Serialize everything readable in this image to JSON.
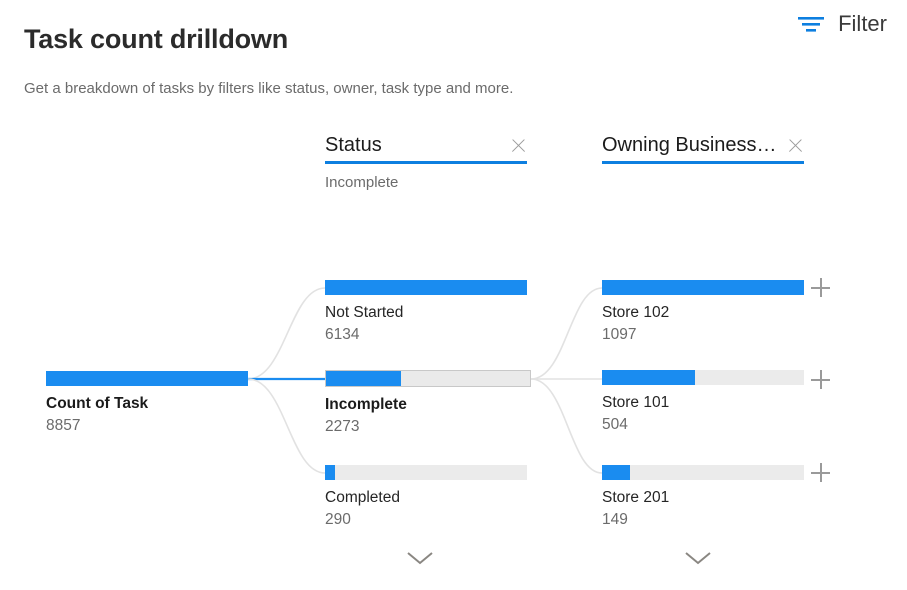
{
  "header": {
    "title": "Task count drilldown",
    "subtitle": "Get a breakdown of tasks by filters like status, owner, task type and more.",
    "filter_label": "Filter",
    "filter_icon": "filter-funnel-icon",
    "accent_color": "#1a8cf0",
    "track_color": "#ebebeb"
  },
  "columns": [
    {
      "title": "Status",
      "selected_value": "Incomplete",
      "close_icon": "close-x-icon"
    },
    {
      "title": "Owning Business…",
      "selected_value": "",
      "close_icon": "close-x-icon"
    }
  ],
  "root": {
    "label": "Count of Task",
    "value": "8857",
    "fill_pct": 100,
    "selected": true
  },
  "level1": {
    "nodes": [
      {
        "label": "Not Started",
        "value": "6134",
        "fill_pct": 100,
        "selected": false,
        "expander": null
      },
      {
        "label": "Incomplete",
        "value": "2273",
        "fill_pct": 37,
        "selected": true,
        "expander": null
      },
      {
        "label": "Completed",
        "value": "290",
        "fill_pct": 5,
        "selected": false,
        "expander": null
      }
    ],
    "more_icon": "chevron-down-icon"
  },
  "level2": {
    "nodes": [
      {
        "label": "Store 102",
        "value": "1097",
        "fill_pct": 100,
        "selected": false,
        "expander": "plus-icon"
      },
      {
        "label": "Store 101",
        "value": "504",
        "fill_pct": 46,
        "selected": false,
        "expander": "plus-icon"
      },
      {
        "label": "Store 201",
        "value": "149",
        "fill_pct": 14,
        "selected": false,
        "expander": "plus-icon"
      }
    ],
    "more_icon": "chevron-down-icon"
  },
  "chart_data": {
    "type": "bar",
    "title": "Task count drilldown",
    "subtitle": "Get a breakdown of tasks by filters like status, owner, task type and more.",
    "root": {
      "category": "Count of Task",
      "value": 8857
    },
    "levels": [
      {
        "field": "Status",
        "selected": "Incomplete",
        "categories": [
          "Not Started",
          "Incomplete",
          "Completed"
        ],
        "values": [
          6134,
          2273,
          290
        ],
        "max": 6134
      },
      {
        "field": "Owning Business…",
        "selected": "",
        "categories": [
          "Store 102",
          "Store 101",
          "Store 201"
        ],
        "values": [
          1097,
          504,
          149
        ],
        "max": 1097
      }
    ],
    "xlabel": "",
    "ylabel": "",
    "grid": false,
    "legend": "none"
  }
}
